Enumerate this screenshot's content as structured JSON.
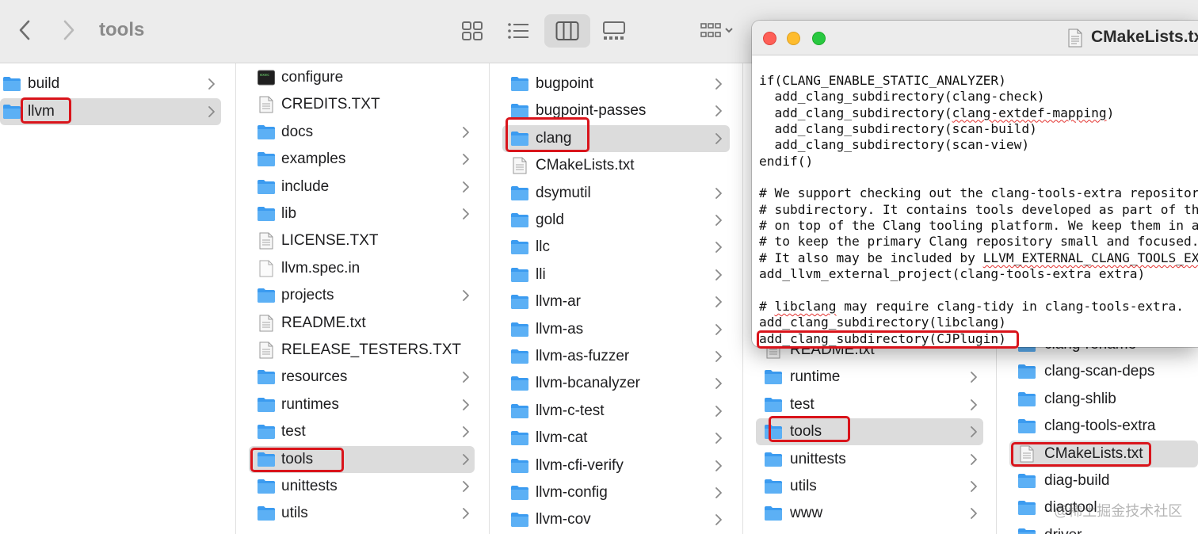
{
  "toolbar": {
    "title": "tools"
  },
  "column1": [
    {
      "name": "build",
      "type": "folder",
      "chevron": true
    },
    {
      "name": "llvm",
      "type": "folder",
      "chevron": true,
      "selected": true
    }
  ],
  "column2": [
    {
      "name": "configure",
      "type": "exec",
      "chevron": false
    },
    {
      "name": "CREDITS.TXT",
      "type": "text",
      "chevron": false
    },
    {
      "name": "docs",
      "type": "folder",
      "chevron": true
    },
    {
      "name": "examples",
      "type": "folder",
      "chevron": true
    },
    {
      "name": "include",
      "type": "folder",
      "chevron": true
    },
    {
      "name": "lib",
      "type": "folder",
      "chevron": true
    },
    {
      "name": "LICENSE.TXT",
      "type": "text",
      "chevron": false
    },
    {
      "name": "llvm.spec.in",
      "type": "blank",
      "chevron": false
    },
    {
      "name": "projects",
      "type": "folder",
      "chevron": true
    },
    {
      "name": "README.txt",
      "type": "text",
      "chevron": false
    },
    {
      "name": "RELEASE_TESTERS.TXT",
      "type": "text",
      "chevron": false
    },
    {
      "name": "resources",
      "type": "folder",
      "chevron": true
    },
    {
      "name": "runtimes",
      "type": "folder",
      "chevron": true
    },
    {
      "name": "test",
      "type": "folder",
      "chevron": true
    },
    {
      "name": "tools",
      "type": "folder",
      "chevron": true,
      "selected": true
    },
    {
      "name": "unittests",
      "type": "folder",
      "chevron": true
    },
    {
      "name": "utils",
      "type": "folder",
      "chevron": true
    }
  ],
  "column3": [
    {
      "name": "bugpoint",
      "type": "folder",
      "chevron": true
    },
    {
      "name": "bugpoint-passes",
      "type": "folder",
      "chevron": true
    },
    {
      "name": "clang",
      "type": "folder",
      "chevron": true,
      "selected": true
    },
    {
      "name": "CMakeLists.txt",
      "type": "text",
      "chevron": false
    },
    {
      "name": "dsymutil",
      "type": "folder",
      "chevron": true
    },
    {
      "name": "gold",
      "type": "folder",
      "chevron": true
    },
    {
      "name": "llc",
      "type": "folder",
      "chevron": true
    },
    {
      "name": "lli",
      "type": "folder",
      "chevron": true
    },
    {
      "name": "llvm-ar",
      "type": "folder",
      "chevron": true
    },
    {
      "name": "llvm-as",
      "type": "folder",
      "chevron": true
    },
    {
      "name": "llvm-as-fuzzer",
      "type": "folder",
      "chevron": true
    },
    {
      "name": "llvm-bcanalyzer",
      "type": "folder",
      "chevron": true
    },
    {
      "name": "llvm-c-test",
      "type": "folder",
      "chevron": true
    },
    {
      "name": "llvm-cat",
      "type": "folder",
      "chevron": true
    },
    {
      "name": "llvm-cfi-verify",
      "type": "folder",
      "chevron": true
    },
    {
      "name": "llvm-config",
      "type": "folder",
      "chevron": true
    },
    {
      "name": "llvm-cov",
      "type": "folder",
      "chevron": true
    }
  ],
  "column4": [
    {
      "name": "README.txt",
      "type": "text",
      "chevron": false
    },
    {
      "name": "runtime",
      "type": "folder",
      "chevron": true
    },
    {
      "name": "test",
      "type": "folder",
      "chevron": true
    },
    {
      "name": "tools",
      "type": "folder",
      "chevron": true,
      "selected": true
    },
    {
      "name": "unittests",
      "type": "folder",
      "chevron": true
    },
    {
      "name": "utils",
      "type": "folder",
      "chevron": true
    },
    {
      "name": "www",
      "type": "folder",
      "chevron": true
    }
  ],
  "column5": [
    {
      "name": "clang-rename",
      "type": "folder",
      "chevron": false
    },
    {
      "name": "clang-scan-deps",
      "type": "folder",
      "chevron": false
    },
    {
      "name": "clang-shlib",
      "type": "folder",
      "chevron": false
    },
    {
      "name": "clang-tools-extra",
      "type": "folder",
      "chevron": false
    },
    {
      "name": "CMakeLists.txt",
      "type": "text",
      "chevron": false,
      "selected": true
    },
    {
      "name": "diag-build",
      "type": "folder",
      "chevron": false
    },
    {
      "name": "diagtool",
      "type": "folder",
      "chevron": false
    },
    {
      "name": "driver",
      "type": "folder",
      "chevron": false
    }
  ],
  "editor": {
    "title": "CMakeLists.txt",
    "lines": [
      "if(CLANG_ENABLE_STATIC_ANALYZER)",
      "  add_clang_subdirectory(clang-check)",
      "  add_clang_subdirectory(clang-extdef-mapping)",
      "  add_clang_subdirectory(scan-build)",
      "  add_clang_subdirectory(scan-view)",
      "endif()",
      "",
      "# We support checking out the clang-tools-extra repository into the 'extra'",
      "# subdirectory. It contains tools developed as part of the Clang/LLVM project",
      "# on top of the Clang tooling platform. We keep them in a separate repository",
      "# to keep the primary Clang repository small and focused.",
      "# It also may be included by LLVM_EXTERNAL_CLANG_TOOLS_EXTRA_SOURCE_DIR.",
      "add_llvm_external_project(clang-tools-extra extra)",
      "",
      "# libclang may require clang-tidy in clang-tools-extra.",
      "add_clang_subdirectory(libclang)",
      "add_clang_subdirectory(CJPlugin)"
    ]
  },
  "watermark": "@稀土掘金技术社区",
  "colors": {
    "folder": "#3b9bf0",
    "highlight": "#d9141b",
    "selection": "#dcdcdc"
  }
}
